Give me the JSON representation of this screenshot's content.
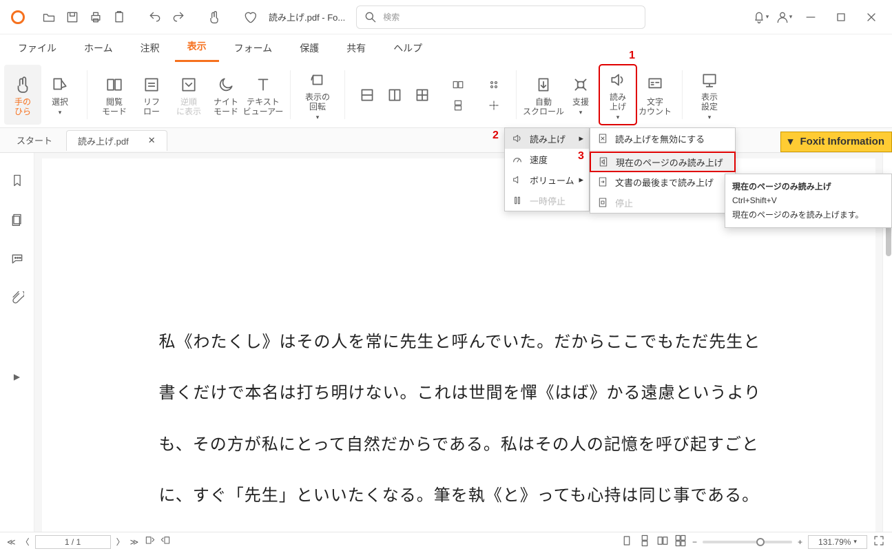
{
  "title": "読み上げ.pdf - Fo...",
  "search_placeholder": "検索",
  "menus": [
    "ファイル",
    "ホーム",
    "注釈",
    "表示",
    "フォーム",
    "保護",
    "共有",
    "ヘルプ"
  ],
  "active_menu": "表示",
  "ribbon": {
    "hand": "手の\nひら",
    "select": "選択",
    "reading": "閲覧\nモード",
    "reflow": "リフ\nロー",
    "reverse": "逆順\nに表示",
    "night": "ナイト\nモード",
    "text_viewer": "テキスト\nビューアー",
    "rotate": "表示の\n回転",
    "autoscroll": "自動\nスクロール",
    "support": "支援",
    "readaloud": "読み\n上げ",
    "wordcount": "文字\nカウント",
    "display": "表示\n設定"
  },
  "callouts": {
    "c1": "1",
    "c2": "2",
    "c3": "3"
  },
  "tabs": {
    "start": "スタート",
    "doc": "読み上げ.pdf"
  },
  "info_banner": "Foxit Information",
  "submenu1": {
    "read": "読み上げ",
    "speed": "速度",
    "volume": "ボリューム",
    "pause": "一時停止"
  },
  "submenu2": {
    "disable": "読み上げを無効にする",
    "current": "現在のページのみ読み上げ",
    "toend": "文書の最後まで読み上げ",
    "stop": "停止"
  },
  "tooltip": {
    "title": "現在のページのみ読み上げ",
    "shortcut": "Ctrl+Shift+V",
    "body": "現在のページのみを読み上げます。"
  },
  "document_text": "私《わたくし》はその人を常に先生と呼んでいた。だからここでもただ先生と書くだけで本名は打ち明けない。これは世間を憚《はば》かる遠慮というよりも、その方が私にとって自然だからである。私はその人の記憶を呼び起すごとに、すぐ「先生」といいたくなる。筆を執《と》っても心持は同じ事である。よそよそしい頭文字《かしらもじ》などはとても使う気にならない。",
  "status": {
    "page": "1 / 1",
    "zoom": "131.79%"
  }
}
